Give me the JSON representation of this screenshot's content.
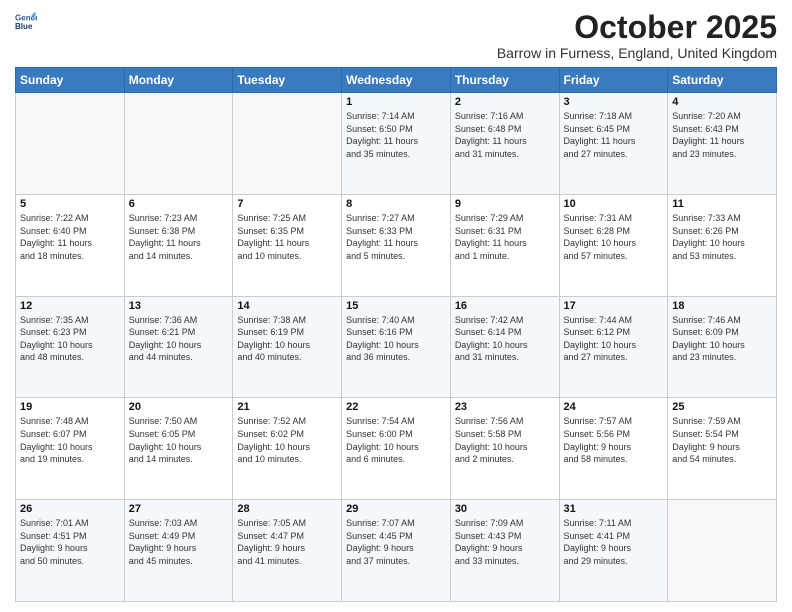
{
  "logo": {
    "line1": "General",
    "line2": "Blue"
  },
  "header": {
    "month": "October 2025",
    "location": "Barrow in Furness, England, United Kingdom"
  },
  "days_of_week": [
    "Sunday",
    "Monday",
    "Tuesday",
    "Wednesday",
    "Thursday",
    "Friday",
    "Saturday"
  ],
  "weeks": [
    [
      {
        "day": "",
        "info": ""
      },
      {
        "day": "",
        "info": ""
      },
      {
        "day": "",
        "info": ""
      },
      {
        "day": "1",
        "info": "Sunrise: 7:14 AM\nSunset: 6:50 PM\nDaylight: 11 hours\nand 35 minutes."
      },
      {
        "day": "2",
        "info": "Sunrise: 7:16 AM\nSunset: 6:48 PM\nDaylight: 11 hours\nand 31 minutes."
      },
      {
        "day": "3",
        "info": "Sunrise: 7:18 AM\nSunset: 6:45 PM\nDaylight: 11 hours\nand 27 minutes."
      },
      {
        "day": "4",
        "info": "Sunrise: 7:20 AM\nSunset: 6:43 PM\nDaylight: 11 hours\nand 23 minutes."
      }
    ],
    [
      {
        "day": "5",
        "info": "Sunrise: 7:22 AM\nSunset: 6:40 PM\nDaylight: 11 hours\nand 18 minutes."
      },
      {
        "day": "6",
        "info": "Sunrise: 7:23 AM\nSunset: 6:38 PM\nDaylight: 11 hours\nand 14 minutes."
      },
      {
        "day": "7",
        "info": "Sunrise: 7:25 AM\nSunset: 6:35 PM\nDaylight: 11 hours\nand 10 minutes."
      },
      {
        "day": "8",
        "info": "Sunrise: 7:27 AM\nSunset: 6:33 PM\nDaylight: 11 hours\nand 5 minutes."
      },
      {
        "day": "9",
        "info": "Sunrise: 7:29 AM\nSunset: 6:31 PM\nDaylight: 11 hours\nand 1 minute."
      },
      {
        "day": "10",
        "info": "Sunrise: 7:31 AM\nSunset: 6:28 PM\nDaylight: 10 hours\nand 57 minutes."
      },
      {
        "day": "11",
        "info": "Sunrise: 7:33 AM\nSunset: 6:26 PM\nDaylight: 10 hours\nand 53 minutes."
      }
    ],
    [
      {
        "day": "12",
        "info": "Sunrise: 7:35 AM\nSunset: 6:23 PM\nDaylight: 10 hours\nand 48 minutes."
      },
      {
        "day": "13",
        "info": "Sunrise: 7:36 AM\nSunset: 6:21 PM\nDaylight: 10 hours\nand 44 minutes."
      },
      {
        "day": "14",
        "info": "Sunrise: 7:38 AM\nSunset: 6:19 PM\nDaylight: 10 hours\nand 40 minutes."
      },
      {
        "day": "15",
        "info": "Sunrise: 7:40 AM\nSunset: 6:16 PM\nDaylight: 10 hours\nand 36 minutes."
      },
      {
        "day": "16",
        "info": "Sunrise: 7:42 AM\nSunset: 6:14 PM\nDaylight: 10 hours\nand 31 minutes."
      },
      {
        "day": "17",
        "info": "Sunrise: 7:44 AM\nSunset: 6:12 PM\nDaylight: 10 hours\nand 27 minutes."
      },
      {
        "day": "18",
        "info": "Sunrise: 7:46 AM\nSunset: 6:09 PM\nDaylight: 10 hours\nand 23 minutes."
      }
    ],
    [
      {
        "day": "19",
        "info": "Sunrise: 7:48 AM\nSunset: 6:07 PM\nDaylight: 10 hours\nand 19 minutes."
      },
      {
        "day": "20",
        "info": "Sunrise: 7:50 AM\nSunset: 6:05 PM\nDaylight: 10 hours\nand 14 minutes."
      },
      {
        "day": "21",
        "info": "Sunrise: 7:52 AM\nSunset: 6:02 PM\nDaylight: 10 hours\nand 10 minutes."
      },
      {
        "day": "22",
        "info": "Sunrise: 7:54 AM\nSunset: 6:00 PM\nDaylight: 10 hours\nand 6 minutes."
      },
      {
        "day": "23",
        "info": "Sunrise: 7:56 AM\nSunset: 5:58 PM\nDaylight: 10 hours\nand 2 minutes."
      },
      {
        "day": "24",
        "info": "Sunrise: 7:57 AM\nSunset: 5:56 PM\nDaylight: 9 hours\nand 58 minutes."
      },
      {
        "day": "25",
        "info": "Sunrise: 7:59 AM\nSunset: 5:54 PM\nDaylight: 9 hours\nand 54 minutes."
      }
    ],
    [
      {
        "day": "26",
        "info": "Sunrise: 7:01 AM\nSunset: 4:51 PM\nDaylight: 9 hours\nand 50 minutes."
      },
      {
        "day": "27",
        "info": "Sunrise: 7:03 AM\nSunset: 4:49 PM\nDaylight: 9 hours\nand 45 minutes."
      },
      {
        "day": "28",
        "info": "Sunrise: 7:05 AM\nSunset: 4:47 PM\nDaylight: 9 hours\nand 41 minutes."
      },
      {
        "day": "29",
        "info": "Sunrise: 7:07 AM\nSunset: 4:45 PM\nDaylight: 9 hours\nand 37 minutes."
      },
      {
        "day": "30",
        "info": "Sunrise: 7:09 AM\nSunset: 4:43 PM\nDaylight: 9 hours\nand 33 minutes."
      },
      {
        "day": "31",
        "info": "Sunrise: 7:11 AM\nSunset: 4:41 PM\nDaylight: 9 hours\nand 29 minutes."
      },
      {
        "day": "",
        "info": ""
      }
    ]
  ]
}
